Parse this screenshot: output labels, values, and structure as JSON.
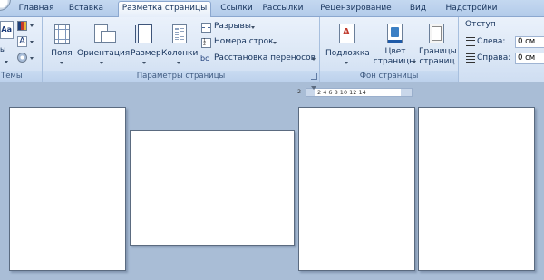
{
  "tabs": [
    {
      "label": "Главная",
      "active": false
    },
    {
      "label": "Вставка",
      "active": false
    },
    {
      "label": "Разметка страницы",
      "active": true
    },
    {
      "label": "Ссылки",
      "active": false
    },
    {
      "label": "Рассылки",
      "active": false
    },
    {
      "label": "Рецензирование",
      "active": false
    },
    {
      "label": "Вид",
      "active": false
    },
    {
      "label": "Надстройки",
      "active": false
    }
  ],
  "ribbon": {
    "themes": {
      "label": "Темы",
      "aa_glyph": "Aa",
      "font_glyph": "A"
    },
    "page_setup": {
      "label": "Параметры страницы",
      "margins": "Поля",
      "orientation": "Ориентация",
      "size": "Размер",
      "columns": "Колонки",
      "breaks": "Разрывы",
      "line_numbers": "Номера строк",
      "hyphenation": "Расстановка переносов",
      "hyphenation_icon_glyph": "bc"
    },
    "page_background": {
      "label": "Фон страницы",
      "watermark": "Подложка",
      "page_color_1": "Цвет",
      "page_color_2": "страницы",
      "page_borders_1": "Границы",
      "page_borders_2": "страниц"
    },
    "paragraph": {
      "indent_title": "Отступ",
      "left_label": "Слева:",
      "left_value": "0 см",
      "right_label": "Справа:",
      "right_value": "0 см"
    }
  },
  "ruler": {
    "ticks": "2  4  6  8  10 12 14",
    "left_marker": "2"
  },
  "colors": {
    "accent": "#1e5aa8",
    "workspace": "#a9bdd6",
    "ribbon": "#dde8f6"
  }
}
